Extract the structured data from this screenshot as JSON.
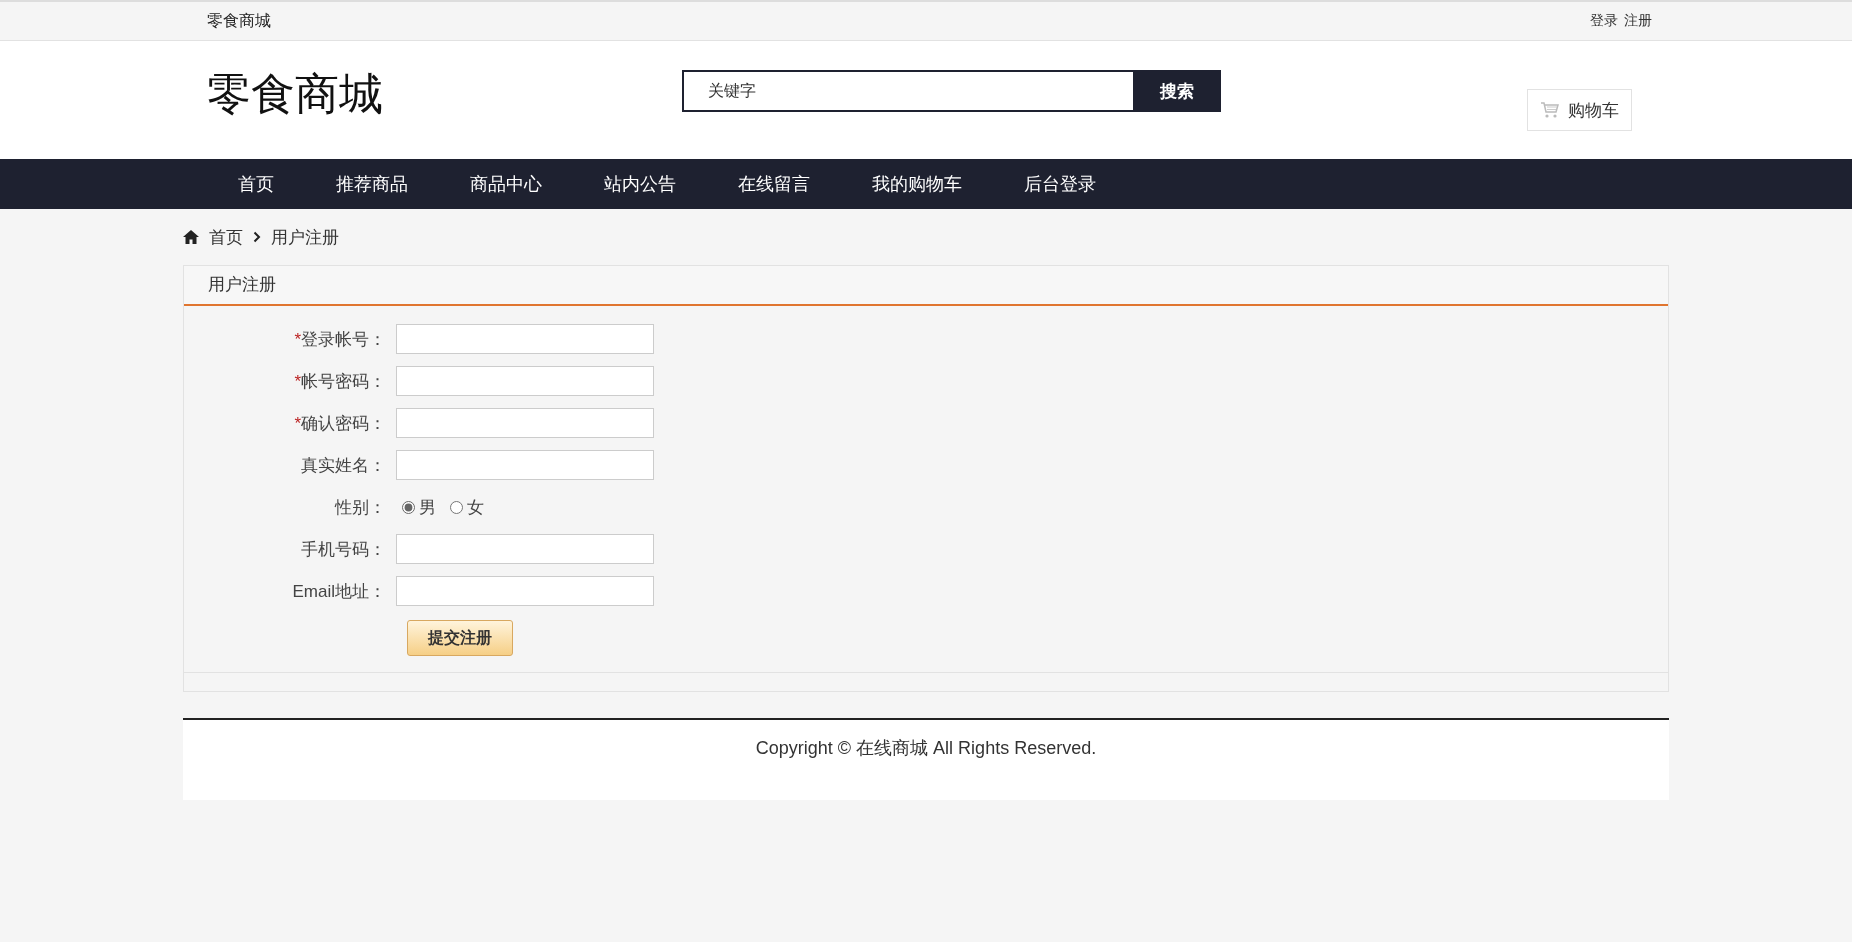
{
  "top_bar": {
    "site_name": "零食商城",
    "links": [
      "登录",
      "注册"
    ]
  },
  "header": {
    "logo": "零食商城",
    "search": {
      "placeholder": "关键字",
      "button": "搜索"
    },
    "cart_button": "购物车"
  },
  "nav": [
    {
      "label": "首页"
    },
    {
      "label": "推荐商品"
    },
    {
      "label": "商品中心"
    },
    {
      "label": "站内公告"
    },
    {
      "label": "在线留言"
    },
    {
      "label": "我的购物车"
    },
    {
      "label": "后台登录"
    }
  ],
  "breadcrumb": [
    "首页",
    "用户注册"
  ],
  "register_panel": {
    "title": "用户注册",
    "fields": [
      {
        "kind": "text",
        "required_mark": "*",
        "label": "登录帐号："
      },
      {
        "kind": "text",
        "required_mark": "*",
        "label": "帐号密码："
      },
      {
        "kind": "text",
        "required_mark": "*",
        "label": "确认密码："
      },
      {
        "kind": "text",
        "label": "真实姓名："
      },
      {
        "kind": "radio",
        "label": "性别：",
        "options": [
          {
            "label": "男",
            "selected": true
          },
          {
            "label": "女",
            "selected": false
          }
        ]
      },
      {
        "kind": "text",
        "label": "手机号码："
      },
      {
        "kind": "text",
        "label": "Email地址："
      }
    ],
    "submit": "提交注册"
  },
  "footer": {
    "text": "Copyright © 在线商城 All Rights Reserved."
  }
}
